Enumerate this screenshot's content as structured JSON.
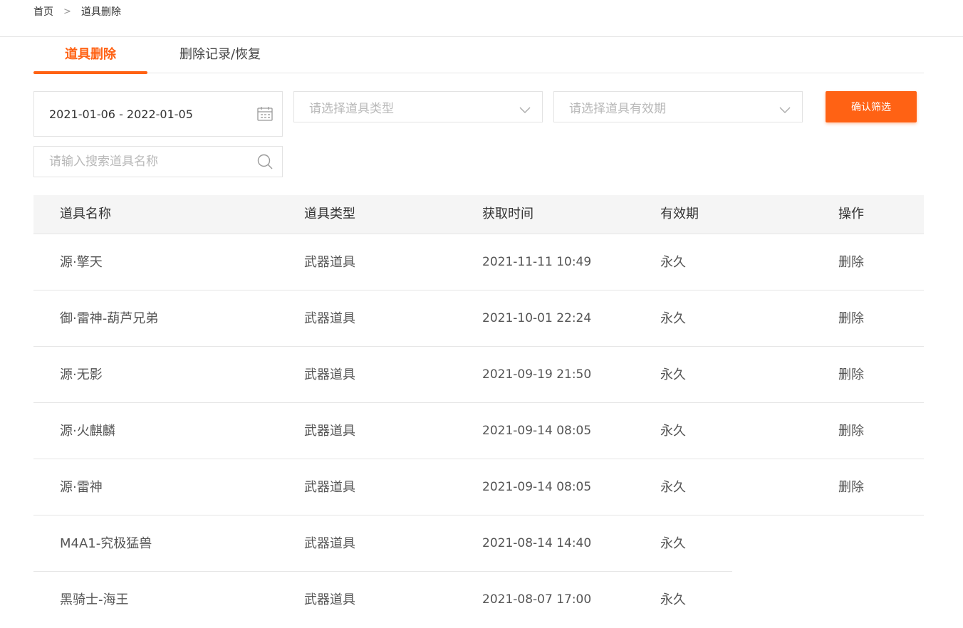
{
  "breadcrumb": {
    "home": "首页",
    "separator": ">",
    "current": "道具删除"
  },
  "tabs": [
    {
      "label": "道具删除",
      "active": true
    },
    {
      "label": "删除记录/恢复",
      "active": false
    }
  ],
  "filters": {
    "date_range": "2021-01-06 - 2022-01-05",
    "type_placeholder": "请选择道具类型",
    "validity_placeholder": "请选择道具有效期",
    "confirm_label": "确认筛选",
    "search_placeholder": "请输入搜索道具名称"
  },
  "table": {
    "headers": [
      "道具名称",
      "道具类型",
      "获取时间",
      "有效期",
      "操作"
    ],
    "rows": [
      {
        "name": "源·擎天",
        "type": "武器道具",
        "time": "2021-11-11 10:49",
        "validity": "永久",
        "action": "删除"
      },
      {
        "name": "御·雷神-葫芦兄弟",
        "type": "武器道具",
        "time": "2021-10-01 22:24",
        "validity": "永久",
        "action": "删除"
      },
      {
        "name": "源·无影",
        "type": "武器道具",
        "time": "2021-09-19 21:50",
        "validity": "永久",
        "action": "删除"
      },
      {
        "name": "源·火麒麟",
        "type": "武器道具",
        "time": "2021-09-14 08:05",
        "validity": "永久",
        "action": "删除"
      },
      {
        "name": "源·雷神",
        "type": "武器道具",
        "time": "2021-09-14 08:05",
        "validity": "永久",
        "action": "删除"
      },
      {
        "name": "M4A1-究极猛兽",
        "type": "武器道具",
        "time": "2021-08-14 14:40",
        "validity": "永久",
        "action": ""
      },
      {
        "name": "黑骑士-海王",
        "type": "武器道具",
        "time": "2021-08-07 17:00",
        "validity": "永久",
        "action": ""
      }
    ]
  },
  "colors": {
    "accent": "#ff6214",
    "header_bg": "#f5f5f5",
    "border": "#e6e6e6"
  },
  "icons": {
    "date": "calendar-icon",
    "dropdown": "chevron-down-icon",
    "search": "search-icon"
  }
}
